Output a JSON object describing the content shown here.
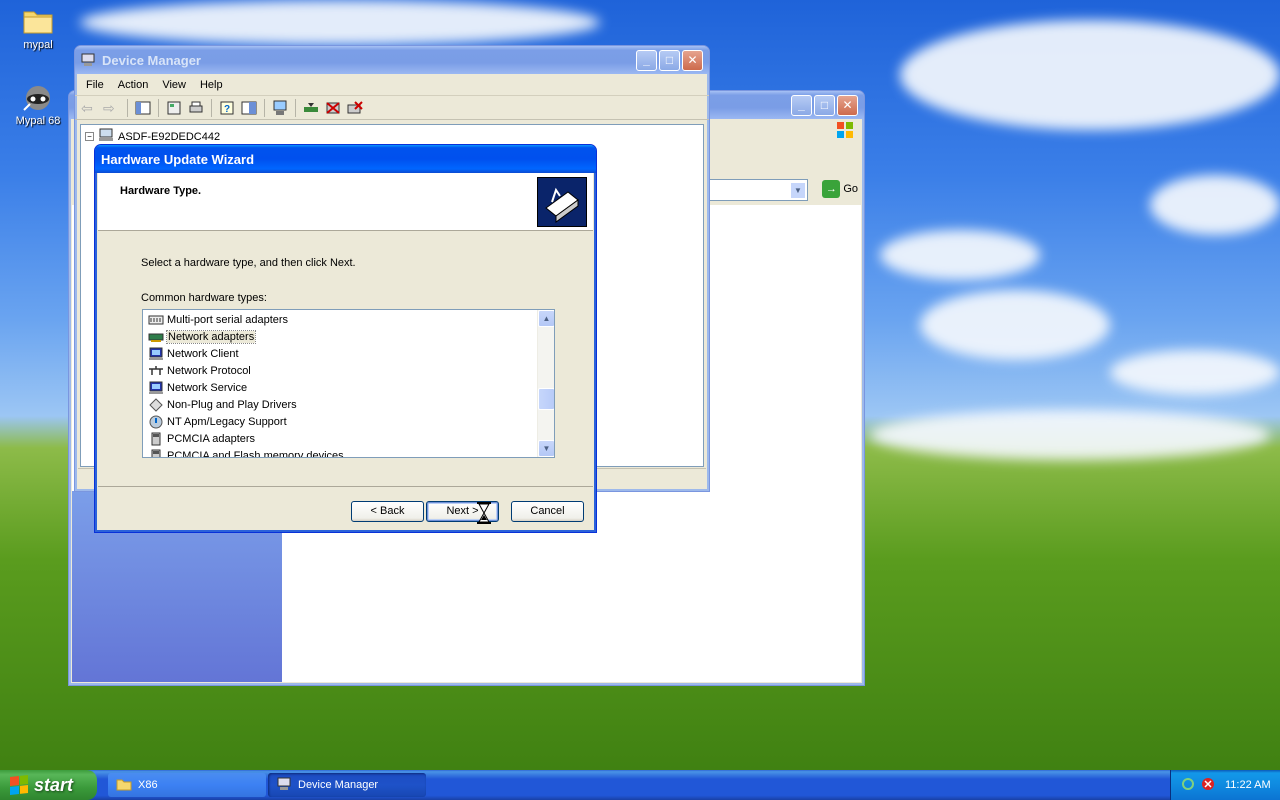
{
  "desktop": {
    "icons": [
      {
        "label": "mypal",
        "icon": "folder-icon"
      },
      {
        "label": "Mypal 68",
        "icon": "raccoon-app-icon"
      }
    ]
  },
  "explorer_window": {
    "go_label": "Go"
  },
  "device_manager": {
    "title": "Device Manager",
    "menu": [
      "File",
      "Action",
      "View",
      "Help"
    ],
    "tree_root": "ASDF-E92DEDC442"
  },
  "wizard": {
    "title": "Hardware Update Wizard",
    "heading": "Hardware Type.",
    "instruction": "Select a hardware type, and then click Next.",
    "list_label": "Common hardware types:",
    "items": [
      {
        "label": "Multi-port serial adapters",
        "icon": "serial-port-icon"
      },
      {
        "label": "Network adapters",
        "icon": "network-card-icon",
        "selected": true
      },
      {
        "label": "Network Client",
        "icon": "network-client-icon"
      },
      {
        "label": "Network Protocol",
        "icon": "network-protocol-icon"
      },
      {
        "label": "Network Service",
        "icon": "network-service-icon"
      },
      {
        "label": "Non-Plug and Play Drivers",
        "icon": "driver-diamond-icon"
      },
      {
        "label": "NT Apm/Legacy Support",
        "icon": "power-icon"
      },
      {
        "label": "PCMCIA adapters",
        "icon": "pcmcia-icon"
      },
      {
        "label": "PCMCIA and Flash memory devices",
        "icon": "flash-card-icon"
      }
    ],
    "buttons": {
      "back": "< Back",
      "next": "Next >",
      "cancel": "Cancel"
    }
  },
  "taskbar": {
    "start_label": "start",
    "tasks": [
      {
        "label": "X86",
        "icon": "folder-icon"
      },
      {
        "label": "Device Manager",
        "icon": "device-manager-icon"
      }
    ],
    "clock": "11:22 AM"
  },
  "colors": {
    "xp_blue": "#0053ee",
    "start_green": "#3a9a3a",
    "window_face": "#ece9d8"
  }
}
